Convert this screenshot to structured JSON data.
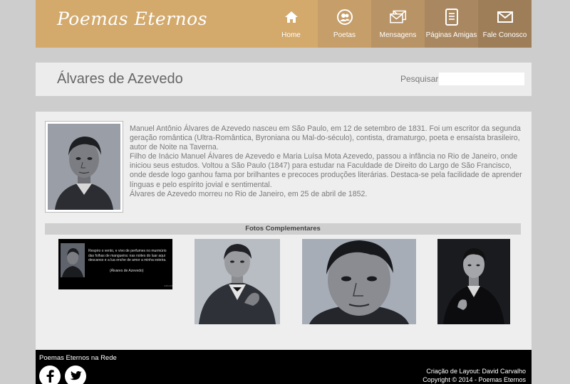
{
  "header": {
    "logo": "Poemas Eternos",
    "nav": [
      {
        "label": "Home",
        "icon": "home-icon"
      },
      {
        "label": "Poetas",
        "icon": "users-icon"
      },
      {
        "label": "Mensagens",
        "icon": "envelopes-icon"
      },
      {
        "label": "Páginas Amigas",
        "icon": "document-icon"
      },
      {
        "label": "Fale Conosco",
        "icon": "mail-icon"
      }
    ]
  },
  "title_bar": {
    "title": "Álvares de Azevedo",
    "search_label": "Pesquisar:",
    "search_value": ""
  },
  "bio": {
    "paragraphs": [
      "Manuel Antônio Álvares de Azevedo nasceu em São Paulo, em 12 de setembro de 1831. Foi um escritor da segunda geração romântica (Ultra-Romântica, Byroniana ou Mal-do-século), contista, dramaturgo, poeta e ensaísta brasileiro, autor de Noite na Taverna.",
      "Filho de Inácio Manuel Álvares de Azevedo e Maria Luísa Mota Azevedo, passou a infância no Rio de Janeiro, onde iniciou seus estudos. Voltou a São Paulo (1847) para estudar na Faculdade de Direito do Largo de São Francisco, onde desde logo ganhou fama por brilhantes e precoces produções literárias. Destaca-se pela facilidade de aprender línguas e pelo espírito jovial e sentimental.",
      "Álvares de Azevedo morreu no Rio de Janeiro, em 25 de abril de 1852."
    ]
  },
  "photos": {
    "heading": "Fotos Complementares",
    "quote_card": {
      "text": "Respiro o vento, e vivo de perfumes no murmúrio das folhas de mangueira: nas noites do luar aqui descanso e a lua enche de amor a minha esteira.",
      "author": "(Álvares de Azevedo)"
    }
  },
  "footer": {
    "title": "Poemas Eternos na Rede",
    "credit_line1": "Criação de Layout: David Carvalho",
    "credit_line2": "Copyright © 2014 - Poemas Eternos"
  },
  "colors": {
    "header": "#d3a96c",
    "nav_dark": "#9e7e58",
    "footer": "#000000"
  }
}
